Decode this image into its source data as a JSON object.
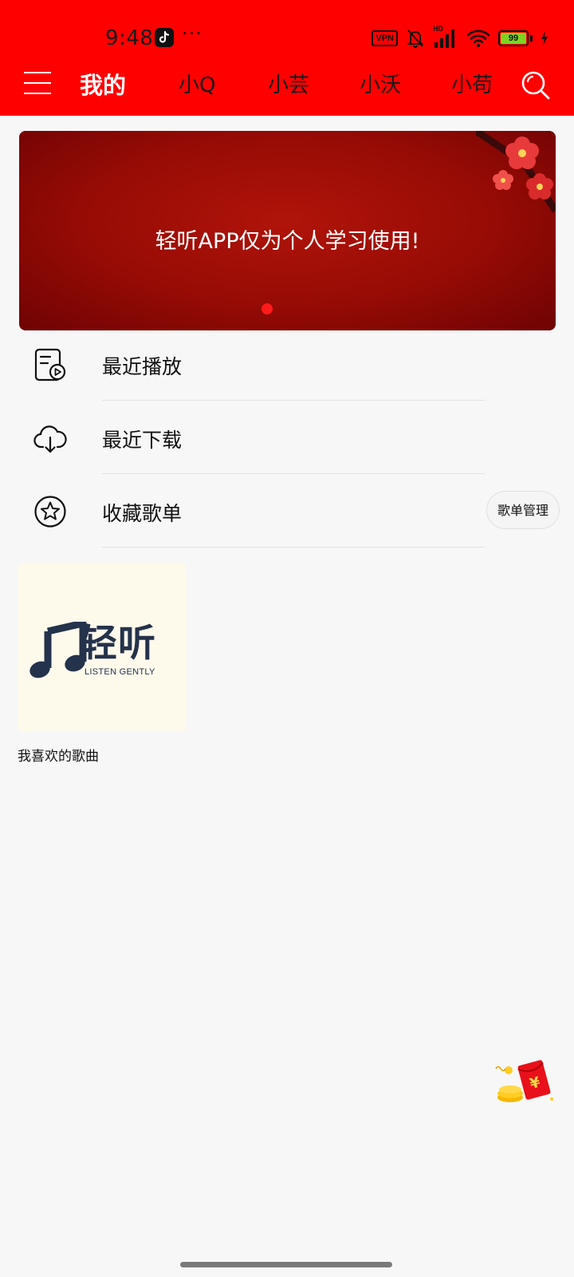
{
  "status_bar": {
    "time": "9:48",
    "more": "···",
    "vpn": "VPN",
    "network": "HD",
    "battery": "99",
    "battery_level": 0.99
  },
  "nav": {
    "tabs": [
      {
        "label": "我的",
        "active": true
      },
      {
        "label": "小Q",
        "active": false
      },
      {
        "label": "小芸",
        "active": false
      },
      {
        "label": "小沃",
        "active": false
      },
      {
        "label": "小苟",
        "active": false
      }
    ]
  },
  "banner": {
    "text": "轻听APP仅为个人学习使用!",
    "page_count": 1,
    "active_index": 0
  },
  "menu": {
    "items": [
      {
        "label": "最近播放",
        "icon": "recent-play-icon"
      },
      {
        "label": "最近下载",
        "icon": "cloud-download-icon"
      },
      {
        "label": "收藏歌单",
        "icon": "star-icon"
      }
    ],
    "manage_button": "歌单管理"
  },
  "playlists": [
    {
      "name": "我喜欢的歌曲",
      "cover_brand": "轻听",
      "cover_subtitle": "LISTEN GENTLY"
    }
  ],
  "colors": {
    "header": "#ff0000",
    "banner": "#a30f07",
    "background": "#f7f7f7",
    "logo": "#25324b"
  }
}
